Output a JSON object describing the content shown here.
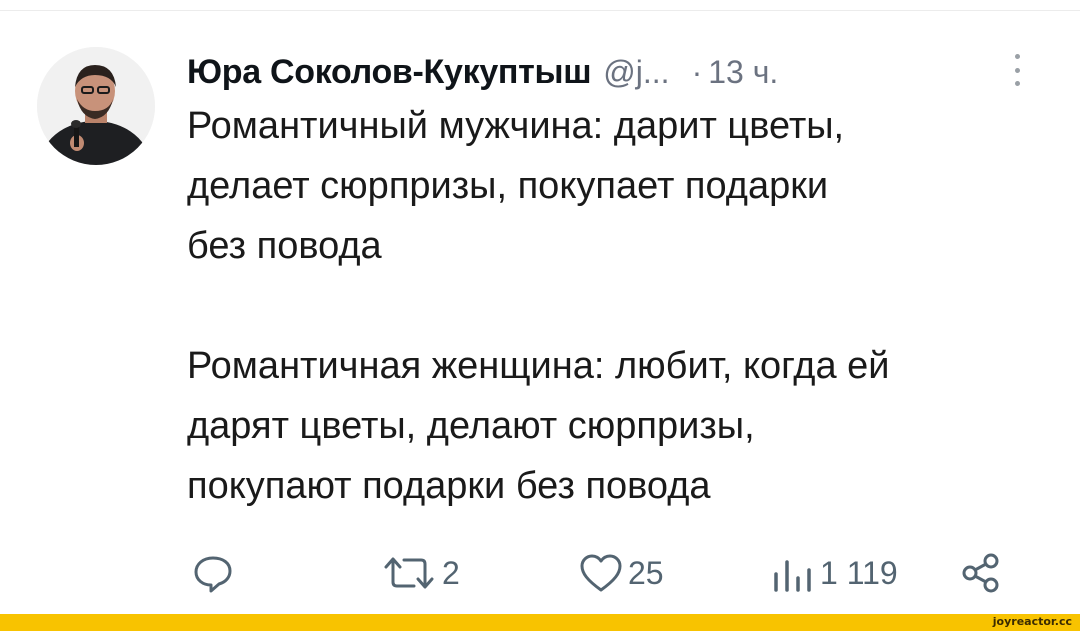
{
  "tweet": {
    "author_name": "Юра Соколов-Кукуптыш",
    "author_handle": "@j...",
    "time_separator": "·",
    "time": "13 ч.",
    "avatar_icon": "avatar-person-with-microphone",
    "more_icon": "vertical-ellipsis-icon",
    "text": {
      "line1": "Романтичный мужчина: дарит цветы,",
      "line2": "делает сюрпризы, покупает подарки",
      "line3": "без повода",
      "line4": "Романтичная женщина: любит, когда ей",
      "line5": "дарят цветы, делают сюрпризы,",
      "line6": "покупают подарки без повода"
    }
  },
  "actions": {
    "reply": {
      "icon": "reply-icon",
      "count": ""
    },
    "retweet": {
      "icon": "retweet-icon",
      "count": "2"
    },
    "like": {
      "icon": "heart-icon",
      "count": "25"
    },
    "views": {
      "icon": "views-bar-chart-icon",
      "count": "1 119"
    },
    "share": {
      "icon": "share-icon"
    }
  },
  "watermark": {
    "text": "joyreactor.cc",
    "bar_color": "#f8c300"
  },
  "colors": {
    "text_primary": "#1a1a1a",
    "text_secondary": "#6b7280",
    "icon": "#536471"
  }
}
